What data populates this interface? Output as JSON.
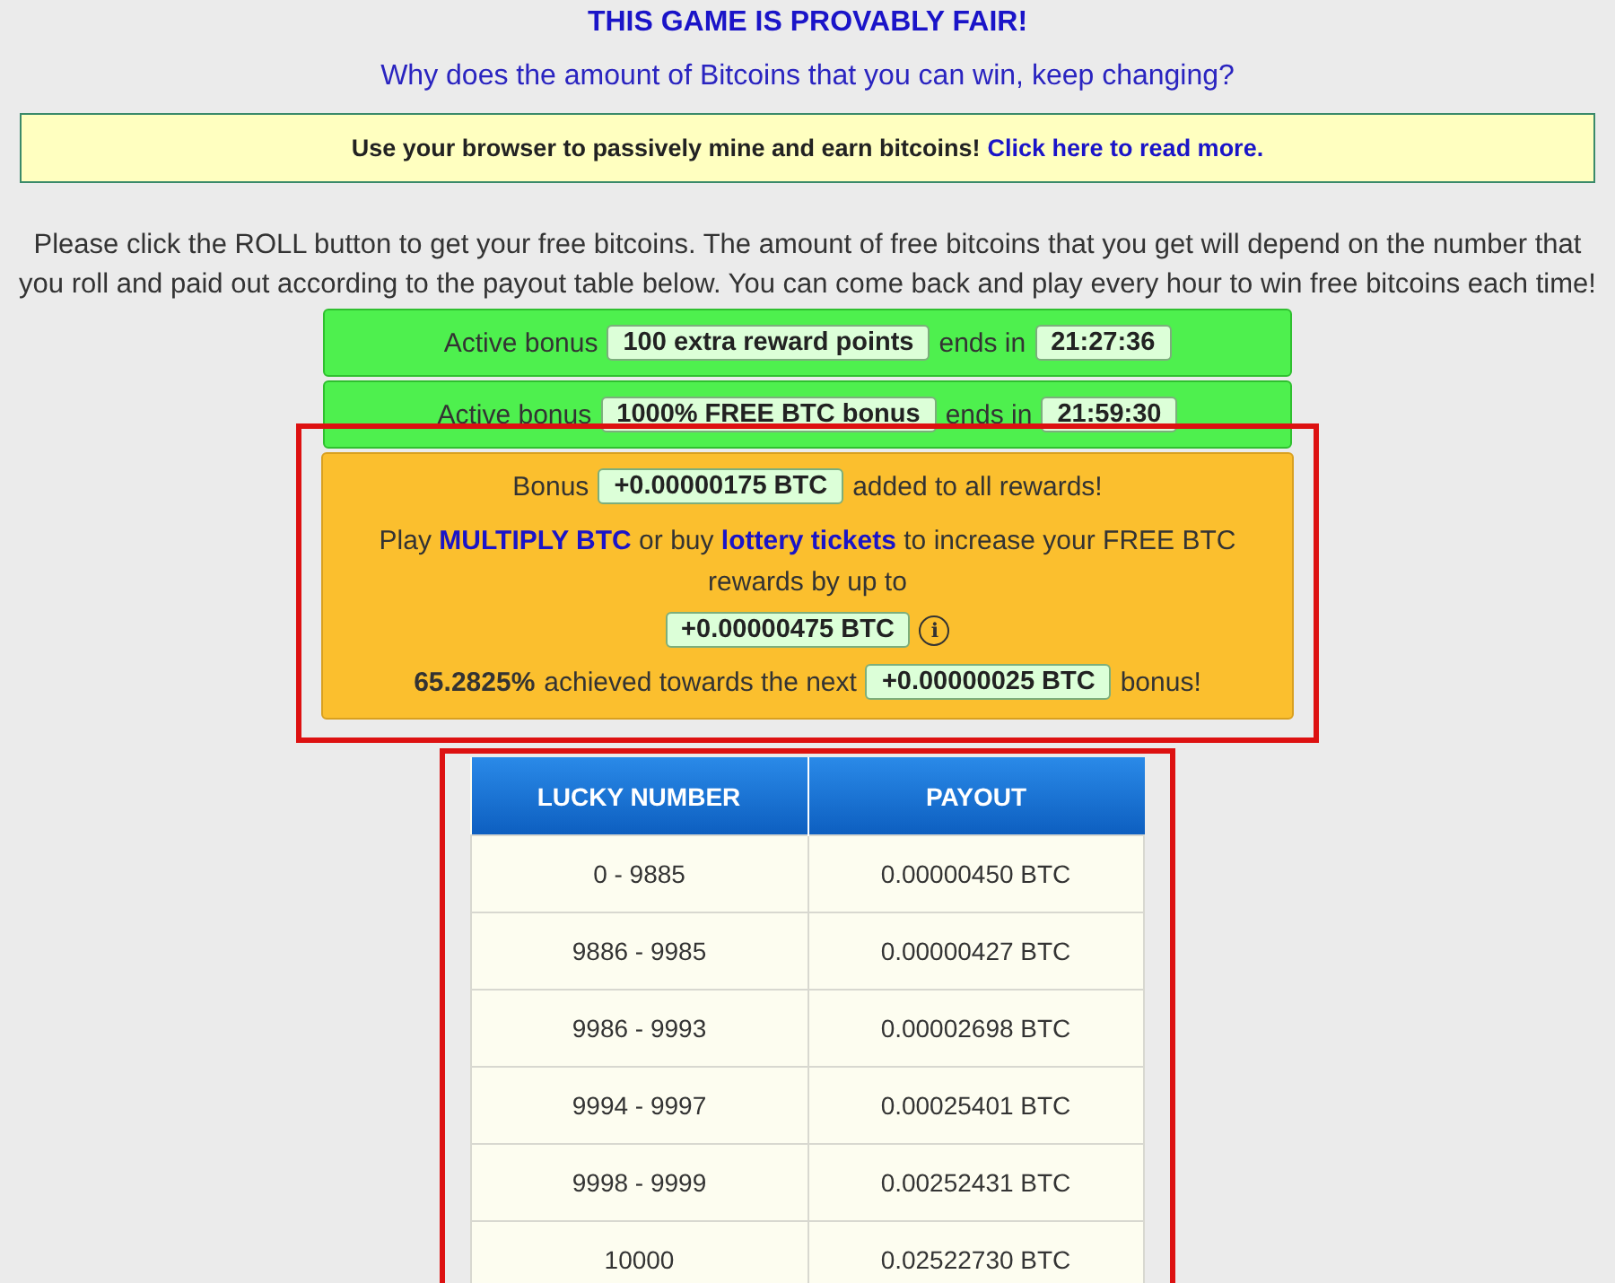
{
  "header": {
    "title": "THIS GAME IS PROVABLY FAIR!",
    "question_link": "Why does the amount of Bitcoins that you can win, keep changing?"
  },
  "notice": {
    "text": "Use your browser to passively mine and earn bitcoins!",
    "link": "Click here to read more."
  },
  "intro": "Please click the ROLL button to get your free bitcoins. The amount of free bitcoins that you get will depend on the number that you roll and paid out according to the payout table below. You can come back and play every hour to win free bitcoins each time!",
  "active_bonuses": [
    {
      "label": "Active bonus",
      "value": "100 extra reward points",
      "ends_label": "ends in",
      "time": "21:27:36"
    },
    {
      "label": "Active bonus",
      "value": "1000% FREE BTC bonus",
      "ends_label": "ends in",
      "time": "21:59:30"
    }
  ],
  "bonus_panel": {
    "bonus_label": "Bonus",
    "bonus_value": "+0.00000175 BTC",
    "bonus_suffix": "added to all rewards!",
    "play_segments": [
      {
        "kind": "text",
        "text": "Play "
      },
      {
        "kind": "link",
        "text": "MULTIPLY BTC"
      },
      {
        "kind": "text",
        "text": " or buy "
      },
      {
        "kind": "link",
        "text": "lottery tickets"
      },
      {
        "kind": "text",
        "text": " to increase your FREE BTC rewards by up to"
      }
    ],
    "max_value": "+0.00000475 BTC",
    "info_icon": "i",
    "progress_percent": "65.2825%",
    "progress_text": "achieved towards the next",
    "next_value": "+0.00000025 BTC",
    "next_suffix": "bonus!"
  },
  "payout_table": {
    "columns": [
      "LUCKY NUMBER",
      "PAYOUT"
    ],
    "rows": [
      [
        "0 - 9885",
        "0.00000450 BTC"
      ],
      [
        "9886 - 9985",
        "0.00000427 BTC"
      ],
      [
        "9986 - 9993",
        "0.00002698 BTC"
      ],
      [
        "9994 - 9997",
        "0.00025401 BTC"
      ],
      [
        "9998 - 9999",
        "0.00252431 BTC"
      ],
      [
        "10000",
        "0.02522730 BTC"
      ]
    ]
  }
}
